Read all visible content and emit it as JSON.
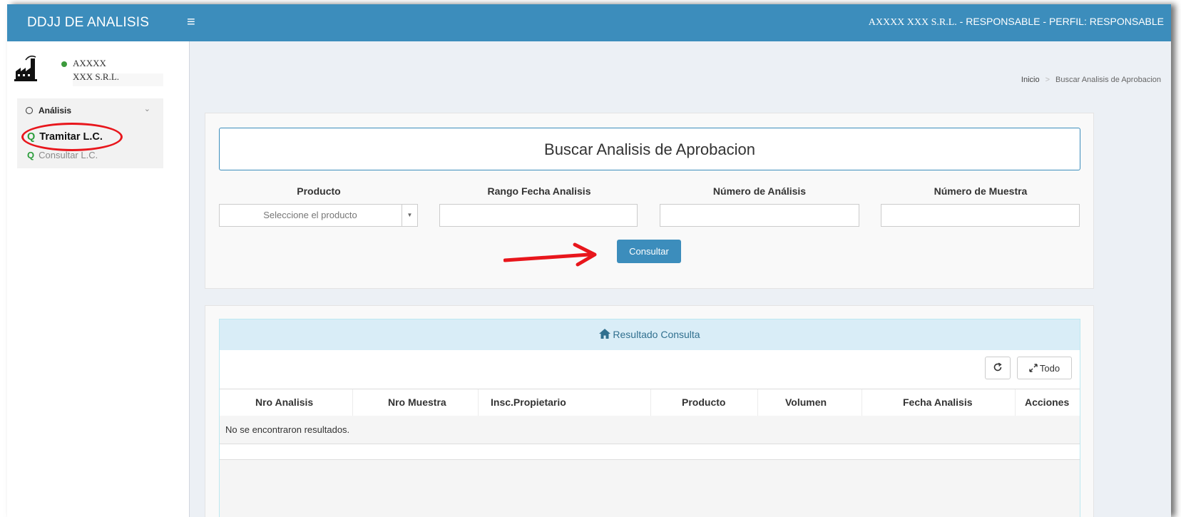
{
  "header": {
    "brand": "DDJJ DE ANALISIS",
    "menu_icon": "hamburger-icon",
    "user_info": "AXXXX  XXX S.R.L.",
    "user_role": "  - RESPONSABLE - PERFIL: RESPONSABLE",
    "bg_color": "#3c8dbc"
  },
  "sidebar": {
    "company_line1": "AXXXX",
    "company_line2": "XXX S.R.L.",
    "status": "online",
    "menu_title": "Análisis",
    "items": [
      {
        "label": "Tramitar L.C.",
        "icon": "search-icon"
      },
      {
        "label": "Consultar L.C.",
        "icon": "search-icon"
      }
    ]
  },
  "breadcrumb": {
    "home": "Inicio",
    "separator": ">",
    "current": "Buscar Analisis de Aprobacion"
  },
  "search": {
    "title": "Buscar Analisis de Aprobacion",
    "fields": [
      {
        "label": "Producto",
        "placeholder": "Seleccione el producto"
      },
      {
        "label": "Rango Fecha Analisis",
        "value": ""
      },
      {
        "label": "Número de Análisis",
        "value": ""
      },
      {
        "label": "Número de Muestra",
        "value": ""
      }
    ],
    "submit_label": "Consultar"
  },
  "results": {
    "title": "Resultado Consulta",
    "refresh_icon": "refresh-icon",
    "expand_label": "Todo",
    "columns": [
      "Nro Analisis",
      "Nro Muestra",
      "Insc.Propietario",
      "Producto",
      "Volumen",
      "Fecha Analisis",
      "Acciones"
    ],
    "empty_message": "No se encontraron resultados."
  },
  "colors": {
    "primary": "#3c8dbc",
    "annotation_red": "#e8161c",
    "panel_heading": "#d9edf7"
  }
}
